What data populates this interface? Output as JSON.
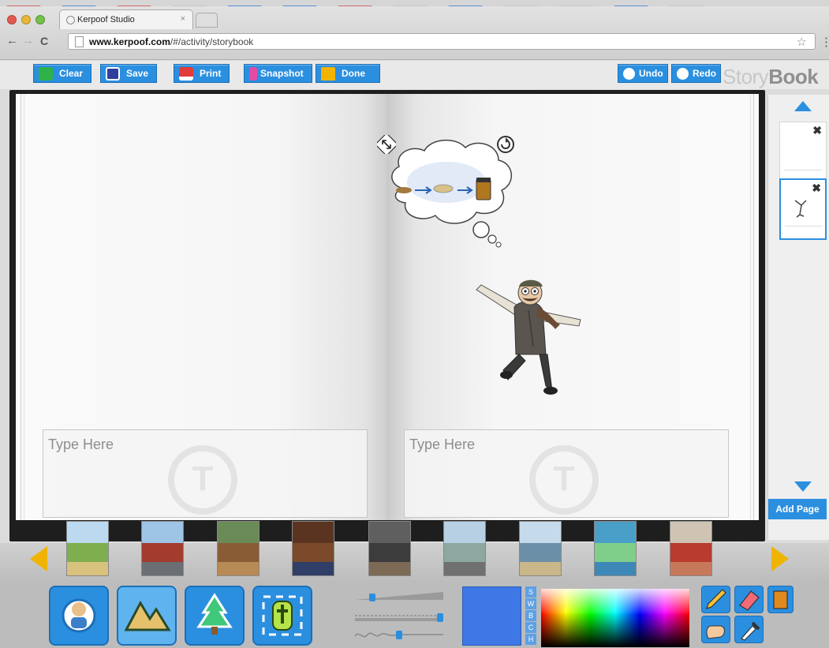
{
  "browser": {
    "tab_title": "Kerpoof Studio",
    "tab_close": "×",
    "url_host": "www.kerpoof.com",
    "url_path": "/#/activity/storybook",
    "back": "←",
    "forward": "→",
    "reload": "C",
    "star": "☆",
    "menu": "⋮"
  },
  "toolbar": {
    "clear_label": "Clear",
    "save_label": "Save",
    "print_label": "Print",
    "snapshot_label": "Snapshot",
    "done_label": "Done",
    "undo_label": "Undo",
    "redo_label": "Redo",
    "brand_light": "Story",
    "brand_bold": "Book"
  },
  "book": {
    "left_placeholder": "Type Here",
    "right_placeholder": "Type Here",
    "text_mark": "T"
  },
  "page_strip": {
    "delete_glyph": "✖",
    "add_page_label": "Add Page",
    "selected_page": 2
  },
  "scenes": [
    {
      "name": "farm-road",
      "sky": "#bcd9ef",
      "mid": "#7fae4e",
      "gnd": "#d9c27d"
    },
    {
      "name": "red-house",
      "sky": "#9ec4e6",
      "mid": "#a33b2e",
      "gnd": "#6b6f73"
    },
    {
      "name": "classroom",
      "sky": "#6a8b57",
      "mid": "#8a5c36",
      "gnd": "#b88a55"
    },
    {
      "name": "doorway",
      "sky": "#5a3420",
      "mid": "#7b4a2a",
      "gnd": "#2f3f68"
    },
    {
      "name": "lab",
      "sky": "#5f5f5f",
      "mid": "#3c3c3c",
      "gnd": "#7d6a55"
    },
    {
      "name": "street",
      "sky": "#b8d0e4",
      "mid": "#8da8a0",
      "gnd": "#707070"
    },
    {
      "name": "town",
      "sky": "#c5daea",
      "mid": "#6c8fa8",
      "gnd": "#c9b78a"
    },
    {
      "name": "lake",
      "sky": "#4a9fc9",
      "mid": "#7fcf8a",
      "gnd": "#3d88b6"
    },
    {
      "name": "living-room",
      "sky": "#cfc4b4",
      "mid": "#b83b2e",
      "gnd": "#c8785a"
    }
  ],
  "color_tabs": [
    "S",
    "W",
    "B",
    "C",
    "H"
  ],
  "colors": {
    "accent": "#2b8fe0",
    "nav_arrow": "#f0b400",
    "current_color": "#3e78e6"
  }
}
